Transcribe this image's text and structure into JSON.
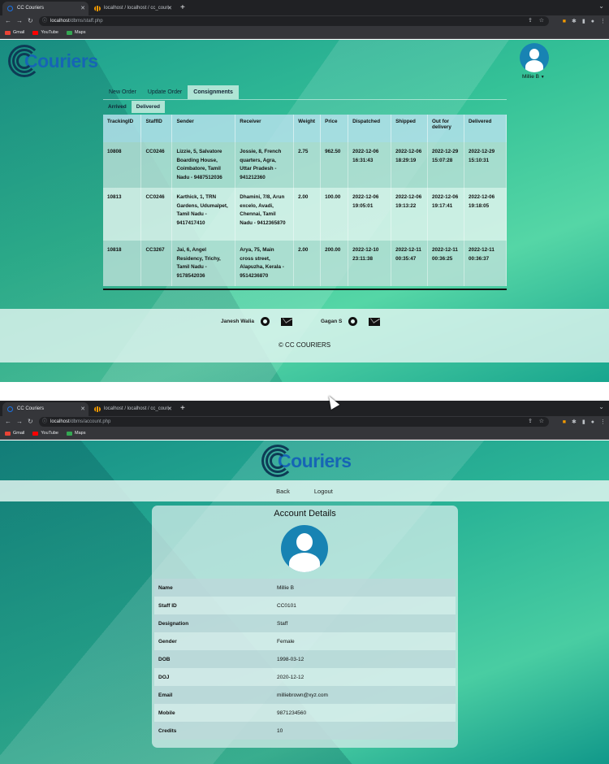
{
  "browser": {
    "tab1_title": "CC Couriers",
    "tab2_title": "localhost / localhost / cc_couri",
    "url1_host": "localhost",
    "url1_path": "/dbms/staff.php",
    "url2_host": "localhost",
    "url2_path": "/dbms/account.php",
    "bookmarks": [
      "Gmail",
      "YouTube",
      "Maps"
    ]
  },
  "brand": {
    "name": "Couriers"
  },
  "staff_page": {
    "user_name": "Millie B",
    "tabs": [
      "New Order",
      "Update Order",
      "Consignments"
    ],
    "active_tab": "Consignments",
    "subtabs": [
      "Arrived",
      "Delivered"
    ],
    "active_subtab": "Delivered",
    "columns": [
      "TrackingID",
      "StaffID",
      "Sender",
      "Receiver",
      "Weight",
      "Price",
      "Dispatched",
      "Shipped",
      "Out for delivery",
      "Delivered"
    ],
    "rows": [
      [
        "10808",
        "CC0246",
        "Lizzie, 5, Salvatore Boarding House, Coimbatore, Tamil Nadu - 9487512036",
        "Jossie, 8, French quarters, Agra, Uttar Pradesh - 941212360",
        "2.75",
        "962.50",
        "2022-12-06 16:31:43",
        "2022-12-06 18:29:19",
        "2022-12-29 15:07:28",
        "2022-12-29 15:10:31"
      ],
      [
        "10813",
        "CC0246",
        "Karthick, 1, TRN Gardens, Udumalpet, Tamil Nadu - 9417417410",
        "Dhamini, 7/8, Arun excelo, Avadi, Chennai, Tamil Nadu - 9412365870",
        "2.00",
        "100.00",
        "2022-12-06 19:05:01",
        "2022-12-06 19:13:22",
        "2022-12-06 19:17:41",
        "2022-12-06 19:18:05"
      ],
      [
        "10818",
        "CC3267",
        "Jai, 6, Angel Residency, Trichy, Tamil Nadu - 9178542036",
        "Arya, 75, Main cross street, Alapuzha, Kerala - 9514236870",
        "2.00",
        "200.00",
        "2022-12-10 23:11:38",
        "2022-12-11 00:35:47",
        "2022-12-11 00:36:25",
        "2022-12-11 00:36:37"
      ]
    ],
    "footer": {
      "contributors": [
        "Janesh Walia",
        "Gagan S"
      ],
      "copyright": "© CC COURIERS"
    }
  },
  "account_page": {
    "nav": [
      "Back",
      "Logout"
    ],
    "title": "Account Details",
    "fields": [
      {
        "label": "Name",
        "value": "Millie B"
      },
      {
        "label": "Staff ID",
        "value": "CC0101"
      },
      {
        "label": "Designation",
        "value": "Staff"
      },
      {
        "label": "Gender",
        "value": "Female"
      },
      {
        "label": "DOB",
        "value": "1998-03-12"
      },
      {
        "label": "DOJ",
        "value": "2020-12-12"
      },
      {
        "label": "Email",
        "value": "milliebrown@xyz.com"
      },
      {
        "label": "Mobile",
        "value": "9871234560"
      },
      {
        "label": "Credits",
        "value": "10"
      }
    ]
  },
  "colors": {
    "brand_blue": "#1665b5",
    "avatar_blue": "#1883b3",
    "teal": "#34c197"
  }
}
